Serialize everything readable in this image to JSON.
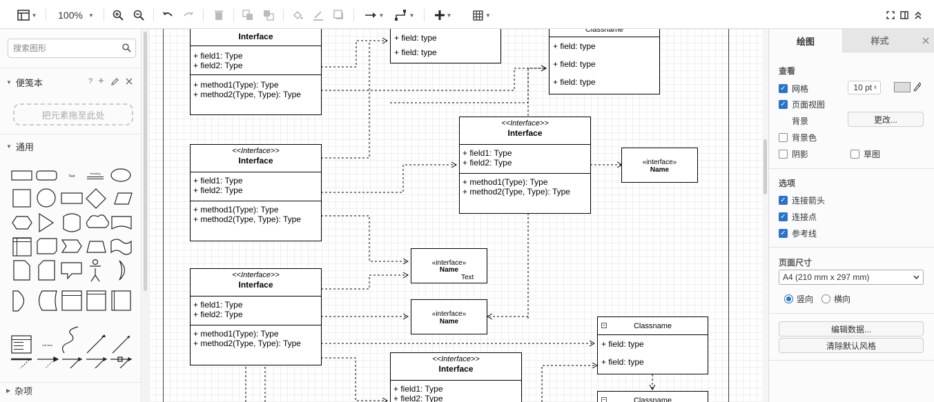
{
  "toolbar": {
    "zoom": "100%",
    "icons": [
      "view-panels-icon",
      "zoom-in-icon",
      "zoom-out-icon",
      "undo-icon",
      "redo-icon",
      "delete-icon",
      "to-front-icon",
      "to-back-icon",
      "fill-color-icon",
      "line-color-icon",
      "shadow-icon",
      "connection-icon",
      "waypoints-icon",
      "insert-icon",
      "table-icon",
      "fullscreen-icon",
      "format-panel-icon",
      "collapse-icon"
    ]
  },
  "sidebar": {
    "search_placeholder": "搜索图形",
    "scratchpad": {
      "title": "便笺本",
      "help": "?",
      "drop_hint": "把元素拖至此处"
    },
    "general": {
      "title": "通用"
    },
    "misc": {
      "title": "杂项"
    },
    "shape_labels": {
      "text": "Text",
      "heading": "Heading",
      "list_item": "List Item"
    }
  },
  "canvas": {
    "boxes": [
      {
        "stereotype": "",
        "name": "Interface",
        "fields": [
          "+ field1: Type",
          "+ field2: Type"
        ],
        "methods": [
          "+ method1(Type): Type",
          "+ method2(Type, Type): Type"
        ]
      },
      {
        "stereotype": "<<Interface>>",
        "name": "Interface",
        "fields": [
          "+ field1: Type",
          "+ field2: Type"
        ],
        "methods": [
          "+ method1(Type): Type",
          "+ method2(Type, Type): Type"
        ]
      },
      {
        "stereotype": "<<Interface>>",
        "name": "Interface",
        "fields": [
          "+ field1: Type",
          "+ field2: Type"
        ],
        "methods": [
          "+ method1(Type): Type",
          "+ method2(Type, Type): Type"
        ]
      },
      {
        "stereotype": "<<Interface>>",
        "name": "Interface",
        "fields": [
          "+ field1: Type",
          "+ field2: Type"
        ],
        "methods": [
          "+ method1(Type): Type",
          "+ method2(Type, Type): Type"
        ]
      },
      {
        "stereotype": "<<Interface>>",
        "name": "Interface",
        "fields": [
          "+ field1: Type",
          "+ field2: Type"
        ],
        "methods": []
      }
    ],
    "top_class_fields": [
      "+ field: type",
      "+ field: type"
    ],
    "top_right_class": {
      "name": "Classname",
      "fields": [
        "+ field: type",
        "+ field: type",
        "+ field: type"
      ]
    },
    "small_interfaces": [
      {
        "stereotype": "«interface»",
        "name": "Name",
        "extra": ""
      },
      {
        "stereotype": "«interface»",
        "name": "Name",
        "extra": "Text"
      },
      {
        "stereotype": "«interface»",
        "name": "Name",
        "extra": ""
      }
    ],
    "classes": [
      {
        "name": "Classname",
        "fields": [
          "+ field: type",
          "+ field: type"
        ]
      },
      {
        "name": "Classname",
        "fields": []
      }
    ]
  },
  "format_panel": {
    "tabs": [
      "绘图",
      "样式"
    ],
    "view": {
      "title": "查看",
      "grid": "网格",
      "grid_checked": true,
      "grid_size": "10 pt",
      "page_view": "页面视图",
      "page_view_checked": true,
      "background": "背景",
      "change_button": "更改...",
      "background_color": "背景色",
      "background_color_checked": false,
      "shadow": "阴影",
      "shadow_checked": false,
      "sketch": "草图",
      "sketch_checked": false
    },
    "options": {
      "title": "选项",
      "connection_arrows": "连接箭头",
      "connection_arrows_checked": true,
      "connection_points": "连接点",
      "connection_points_checked": true,
      "guides": "参考线",
      "guides_checked": true
    },
    "page_size": {
      "title": "页面尺寸",
      "selected": "A4 (210 mm x 297 mm)",
      "portrait": "竖向",
      "landscape": "横向",
      "orientation": "portrait"
    },
    "edit_data_button": "编辑数据...",
    "clear_style_button": "清除默认风格"
  },
  "colors": {
    "accent": "#2a73c9",
    "grid_line": "#eeeeee"
  }
}
